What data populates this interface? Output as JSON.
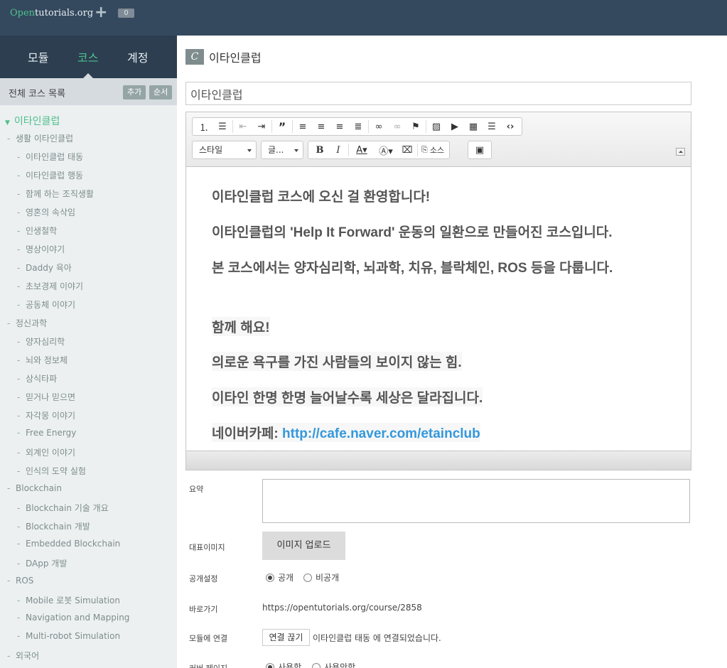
{
  "topbar": {
    "logo_prefix": "Open",
    "logo_rest": "tutorials.org",
    "badge_count": "0"
  },
  "sidebar": {
    "tabs": [
      "모듈",
      "코스",
      "계정"
    ],
    "active_tab": "코스",
    "list_title": "전체 코스 목록",
    "add_label": "추가",
    "order_label": "순서",
    "root_label": "이타인클럽",
    "items": [
      {
        "level": 1,
        "label": "생활 이타인클럽"
      },
      {
        "level": 2,
        "label": "이타인클럽 태동"
      },
      {
        "level": 2,
        "label": "이타인클럽 행동"
      },
      {
        "level": 2,
        "label": "함께 하는 조직생활"
      },
      {
        "level": 2,
        "label": "영혼의 속삭임"
      },
      {
        "level": 2,
        "label": "인생철학"
      },
      {
        "level": 2,
        "label": "명상이야기"
      },
      {
        "level": 2,
        "label": "Daddy 육아"
      },
      {
        "level": 2,
        "label": "초보경제 이야기"
      },
      {
        "level": 2,
        "label": "공동체 이야기"
      },
      {
        "level": 1,
        "label": "정신과학"
      },
      {
        "level": 2,
        "label": "양자심리학"
      },
      {
        "level": 2,
        "label": "뇌와 정보체"
      },
      {
        "level": 2,
        "label": "상식타파"
      },
      {
        "level": 2,
        "label": "믿거나 믿으면"
      },
      {
        "level": 2,
        "label": "자각몽 이야기"
      },
      {
        "level": 2,
        "label": "Free Energy"
      },
      {
        "level": 2,
        "label": "외계인 이야기"
      },
      {
        "level": 2,
        "label": "인식의 도약 실험"
      },
      {
        "level": 1,
        "label": "Blockchain"
      },
      {
        "level": 2,
        "label": "Blockchain 기술 개요"
      },
      {
        "level": 2,
        "label": "Blockchain 개발"
      },
      {
        "level": 2,
        "label": "Embedded Blockchain"
      },
      {
        "level": 2,
        "label": "DApp 개발"
      },
      {
        "level": 1,
        "label": "ROS"
      },
      {
        "level": 2,
        "label": "Mobile 로봇 Simulation"
      },
      {
        "level": 2,
        "label": "Navigation and Mapping"
      },
      {
        "level": 2,
        "label": "Multi-robot Simulation"
      },
      {
        "level": 1,
        "label": "외국어"
      }
    ]
  },
  "main": {
    "icon_letter": "C",
    "page_title": "이타인클럽",
    "title_input_value": "이타인클럽",
    "toolbar": {
      "style_combo": "스타일",
      "font_combo": "글...",
      "source_label": "소스"
    },
    "editor_lines": [
      "이타인클럽 코스에 오신 걸 환영합니다!",
      "이타인클럽의 'Help It Forward' 운동의 일환으로 만들어진 코스입니다.",
      "본 코스에서는 양자심리학, 뇌과학, 치유, 블락체인, ROS 등을 다룹니다.",
      "함께 해요!",
      "의로운 욕구를 가진 사람들의 보이지 않는 힘.",
      "이타인 한명 한명 늘어날수록 세상은 달라집니다."
    ],
    "editor_link_prefix": "네이버카페: ",
    "editor_link": "http://cafe.naver.com/etainclub",
    "form": {
      "summary_label": "요약",
      "image_label": "대표이미지",
      "upload_label": "이미지 업로드",
      "visibility_label": "공개설정",
      "public_label": "공개",
      "private_label": "비공개",
      "shortcut_label": "바로가기",
      "shortcut_url": "https://opentutorials.org/course/2858",
      "module_link_label": "모듈에 연결",
      "unlink_label": "연결 끊기",
      "module_link_text": "이타인클럽 태동 에 연결되었습니다.",
      "cover_label": "커버 페이지",
      "use_label": "사용함",
      "nouse_label": "사용안함"
    }
  },
  "colors": {
    "topbar": "#34495e",
    "sidebar_dark": "#2c3e50",
    "accent_green": "#4fc08d",
    "link_blue": "#3498db"
  }
}
